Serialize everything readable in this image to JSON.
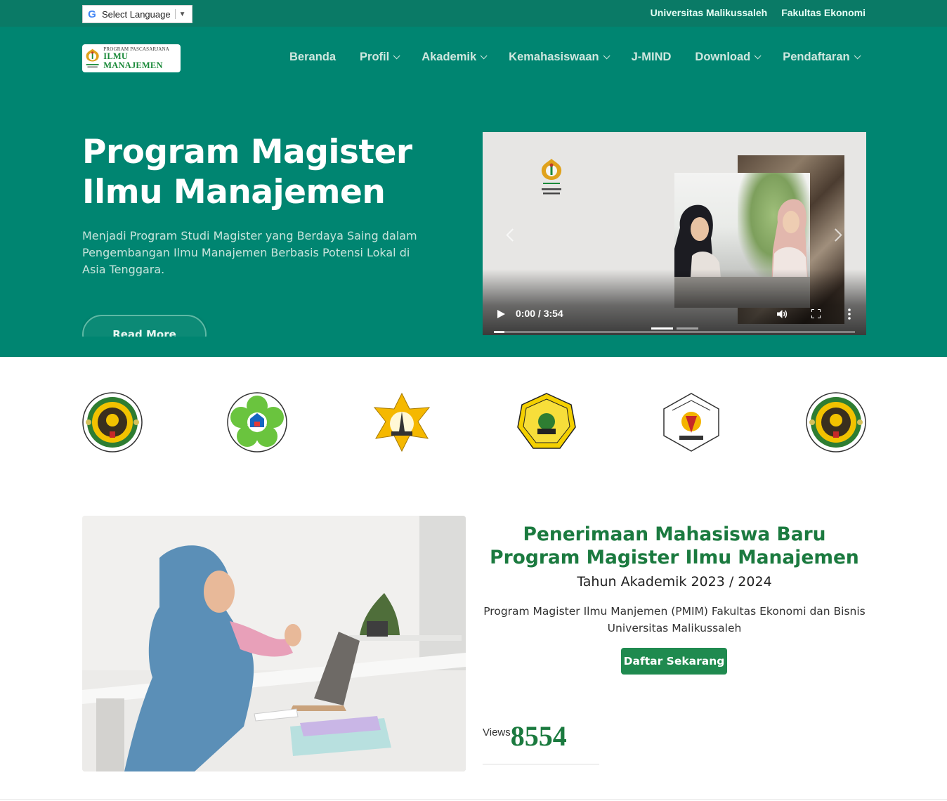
{
  "topbar": {
    "language_label": "Select Language",
    "links": [
      "Universitas Malikussaleh",
      "Fakultas Ekonomi"
    ]
  },
  "logo": {
    "small": "PROGRAM PASCASARJANA",
    "big": "ILMU MANAJEMEN"
  },
  "nav": {
    "items": [
      {
        "label": "Beranda",
        "dropdown": false
      },
      {
        "label": "Profil",
        "dropdown": true
      },
      {
        "label": "Akademik",
        "dropdown": true
      },
      {
        "label": "Kemahasiswaan",
        "dropdown": true
      },
      {
        "label": "J-MIND",
        "dropdown": false
      },
      {
        "label": "Download",
        "dropdown": true
      },
      {
        "label": "Pendaftaran",
        "dropdown": true
      }
    ]
  },
  "hero": {
    "title": "Program Magister Ilmu Manajemen",
    "subtitle": "Menjadi Program Studi Magister yang Berdaya Saing dalam Pengembangan Ilmu Manajemen Berbasis Potensi Lokal di Asia Tenggara.",
    "read_more": "Read More"
  },
  "video": {
    "time": "0:00 / 3:54",
    "progress": 0.03
  },
  "admission": {
    "title": "Penerimaan Mahasiswa Baru Program Magister Ilmu Manajemen",
    "year": "Tahun Akademik 2023 / 2024",
    "description": "Program Magister Ilmu Manjemen (PMIM) Fakultas Ekonomi dan Bisnis Universitas Malikussaleh",
    "button": "Daftar Sekarang",
    "views_label": "Views",
    "views_count": "8554"
  },
  "colors": {
    "topbar": "#0a7a66",
    "hero": "#008571",
    "accent_green": "#1b7a3f",
    "button_green": "#1f8a4f"
  }
}
